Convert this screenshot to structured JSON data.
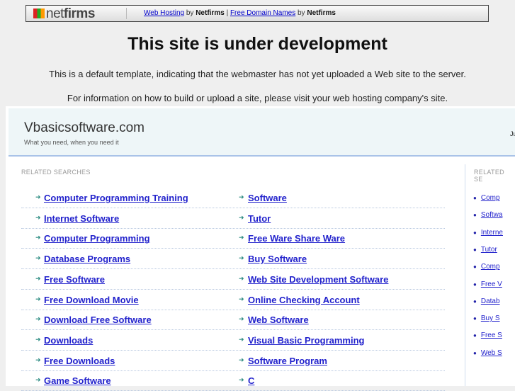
{
  "banner": {
    "logo_text_light": "net",
    "logo_text_bold": "firms",
    "link1": "Web Hosting",
    "by1": "by",
    "brand1": "Netfirms",
    "sep": "|",
    "link2": "Free Domain Names",
    "by2": "by",
    "brand2": "Netfirms"
  },
  "title": "This site is under development",
  "info1": "This is a default template, indicating that the webmaster has not yet uploaded a Web site to the server.",
  "info2": "For information on how to build or upload a site, please visit your web hosting company's site.",
  "site": {
    "name": "Vbasicsoftware.com",
    "tagline": "What you need, when you need it",
    "right_text": "Ju"
  },
  "related_label": "RELATED SEARCHES",
  "related_label_right": "RELATED SE",
  "rows": [
    [
      "Computer Programming Training",
      "Software"
    ],
    [
      "Internet Software",
      "Tutor"
    ],
    [
      "Computer Programming",
      "Free Ware Share Ware"
    ],
    [
      "Database Programs",
      "Buy Software"
    ],
    [
      "Free Software",
      "Web Site Development Software"
    ],
    [
      "Free Download Movie",
      "Online Checking Account"
    ],
    [
      "Download Free Software",
      "Web Software"
    ],
    [
      "Downloads",
      "Visual Basic Programming"
    ],
    [
      "Free Downloads",
      "Software Program"
    ],
    [
      "Game Software",
      "C"
    ]
  ],
  "right_links": [
    "Comp",
    "Softwa",
    "Interne",
    "Tutor",
    "Comp",
    "Free V",
    "Datab",
    "Buy S",
    "Free S",
    "Web S"
  ]
}
